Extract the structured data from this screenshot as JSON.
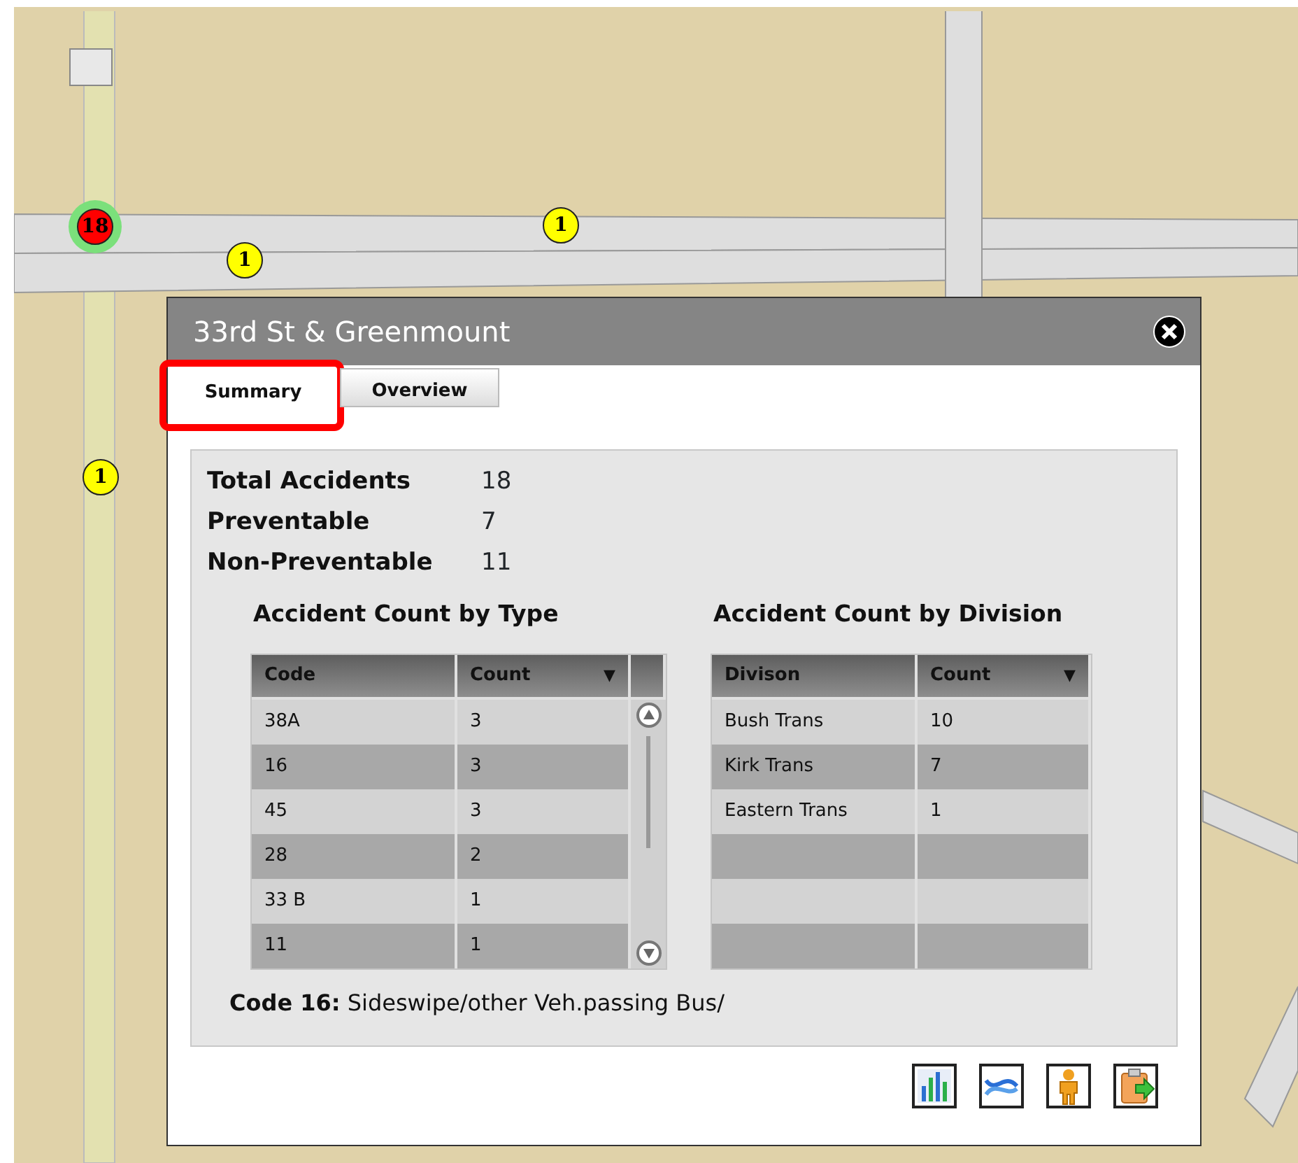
{
  "markers": [
    {
      "count": "18",
      "color": "#ff0000",
      "selected": true
    },
    {
      "count": "1",
      "color": "#ffff00",
      "selected": false
    },
    {
      "count": "1",
      "color": "#ffff00",
      "selected": false
    },
    {
      "count": "1",
      "color": "#ffff00",
      "selected": false
    }
  ],
  "popup": {
    "title": "33rd St & Greenmount",
    "tabs": [
      {
        "label": "Summary",
        "selected": true,
        "highlighted": true
      },
      {
        "label": "Overview",
        "selected": false,
        "highlighted": false
      }
    ],
    "stats": [
      {
        "label": "Total Accidents",
        "value": "18"
      },
      {
        "label": "Preventable",
        "value": "7"
      },
      {
        "label": "Non-Preventable",
        "value": "11"
      }
    ],
    "tables": [
      {
        "title": "Accident Count by Type",
        "scrollbar": true,
        "columns": [
          {
            "label": "Code"
          },
          {
            "label": "Count",
            "sort_glyph": "▼"
          }
        ],
        "rows": [
          [
            "38A",
            "3"
          ],
          [
            "16",
            "3"
          ],
          [
            "45",
            "3"
          ],
          [
            "28",
            "2"
          ],
          [
            "33 B",
            "1"
          ],
          [
            "11",
            "1"
          ]
        ]
      },
      {
        "title": "Accident Count by Division",
        "scrollbar": false,
        "columns": [
          {
            "label": "Divison"
          },
          {
            "label": "Count",
            "sort_glyph": "▼"
          }
        ],
        "rows": [
          [
            "Bush Trans",
            "10"
          ],
          [
            "Kirk Trans",
            "7"
          ],
          [
            "Eastern Trans",
            "1"
          ]
        ]
      }
    ],
    "note": "**Code 16:** Sideswipe/other Veh.passing Bus/",
    "tools": [
      {
        "kind": "chart"
      },
      {
        "kind": "route"
      },
      {
        "kind": "person"
      },
      {
        "kind": "export"
      }
    ]
  }
}
